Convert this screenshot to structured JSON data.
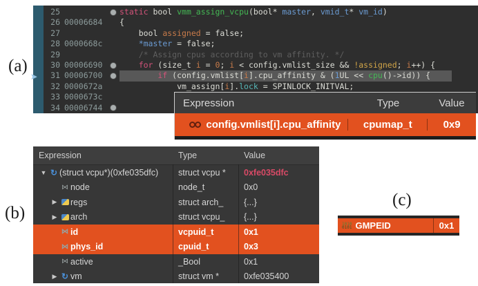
{
  "labels": {
    "a": "(a)",
    "b": "(b)",
    "c": "(c)"
  },
  "icons": {
    "instruction_pointer": "➤",
    "pointer": "↻",
    "variable": "⋈",
    "expander_open": "▼",
    "expander_closed": "▶",
    "reg_bits_line1": "1010",
    "reg_bits_line2": "0101"
  },
  "colors": {
    "selection_orange": "#e2511f",
    "editor_bg": "#2e2e2e",
    "gutter_teal": "#2d5b6e",
    "changed_value_red": "#d84a66",
    "pointer_blue": "#4a90d9"
  },
  "editor": {
    "lines": [
      {
        "num": "25",
        "addr": "",
        "bp": true,
        "current": false,
        "tokens": [
          [
            "k",
            "static"
          ],
          [
            "w",
            " bool "
          ],
          [
            "f",
            "vmm_assign_vcpu"
          ],
          [
            "w",
            "(bool* "
          ],
          [
            "v",
            "master"
          ],
          [
            "w",
            ", "
          ],
          [
            "v",
            "vmid_t"
          ],
          [
            "w",
            "* "
          ],
          [
            "v",
            "vm_id"
          ],
          [
            "w",
            ")"
          ]
        ]
      },
      {
        "num": "26",
        "addr": "00006684",
        "bp": false,
        "current": false,
        "tokens": [
          [
            "w",
            "{"
          ]
        ]
      },
      {
        "num": "27",
        "addr": "",
        "bp": false,
        "current": false,
        "tokens": [
          [
            "w",
            "    bool "
          ],
          [
            "o",
            "assigned"
          ],
          [
            "w",
            " = false;"
          ]
        ]
      },
      {
        "num": "28",
        "addr": "0000668c",
        "bp": false,
        "current": false,
        "tokens": [
          [
            "w",
            "    "
          ],
          [
            "v",
            "*master"
          ],
          [
            "w",
            " = false;"
          ]
        ]
      },
      {
        "num": "29",
        "addr": "",
        "bp": false,
        "current": false,
        "tokens": [
          [
            "c",
            "    /* Assign cpus according to vm affinity. */"
          ]
        ]
      },
      {
        "num": "30",
        "addr": "00006690",
        "bp": true,
        "current": false,
        "tokens": [
          [
            "k",
            "    for"
          ],
          [
            "w",
            " (size_t "
          ],
          [
            "o",
            "i"
          ],
          [
            "w",
            " = "
          ],
          [
            "o",
            "0"
          ],
          [
            "w",
            "; "
          ],
          [
            "o",
            "i"
          ],
          [
            "w",
            " < config.vmlist_size && "
          ],
          [
            "y",
            "!assigned"
          ],
          [
            "w",
            "; "
          ],
          [
            "o",
            "i"
          ],
          [
            "w",
            "++) {"
          ]
        ]
      },
      {
        "num": "31",
        "addr": "00006700",
        "bp": true,
        "current": true,
        "tokens": [
          [
            "k",
            "        if"
          ],
          [
            "w",
            " (config.vmlist["
          ],
          [
            "o",
            "i"
          ],
          [
            "w",
            "].cpu_affinity & ("
          ],
          [
            "v",
            "1"
          ],
          [
            "w",
            "UL << "
          ],
          [
            "f",
            "cpu"
          ],
          [
            "w",
            "()->id)) {"
          ]
        ]
      },
      {
        "num": "32",
        "addr": "0000672a",
        "bp": false,
        "current": false,
        "tokens": [
          [
            "w",
            "            vm_assign["
          ],
          [
            "o",
            "i"
          ],
          [
            "w",
            "]."
          ],
          [
            "t",
            "lock"
          ],
          [
            "w",
            " = SPINLOCK_INITVAL;"
          ]
        ]
      },
      {
        "num": "33",
        "addr": "0000673c",
        "bp": false,
        "current": false,
        "tokens": []
      },
      {
        "num": "34",
        "addr": "00006744",
        "bp": true,
        "current": false,
        "tokens": []
      }
    ]
  },
  "watch_popup": {
    "headers": [
      "Expression",
      "Type",
      "Value"
    ],
    "row": {
      "expression": "config.vmlist[i].cpu_affinity",
      "type": "cpumap_t",
      "value": "0x9"
    }
  },
  "variables_table": {
    "headers": [
      "Expression",
      "Type",
      "Value"
    ],
    "rows": [
      {
        "expander": "▼",
        "icon": "pointer",
        "indent": 0,
        "name": "(struct vcpu*)(0xfe035dfc)",
        "type": "struct vcpu *",
        "value": "0xfe035dfc",
        "red": true,
        "selected": false
      },
      {
        "expander": "",
        "icon": "var",
        "indent": 1,
        "name": "node",
        "type": "node_t",
        "value": "0x0",
        "red": false,
        "selected": false
      },
      {
        "expander": "▶",
        "icon": "struct",
        "indent": 1,
        "name": "regs",
        "type": "struct arch_",
        "value": "{...}",
        "red": false,
        "selected": false
      },
      {
        "expander": "▶",
        "icon": "struct",
        "indent": 1,
        "name": "arch",
        "type": "struct vcpu_",
        "value": "{...}",
        "red": false,
        "selected": false
      },
      {
        "expander": "",
        "icon": "var",
        "indent": 1,
        "name": "id",
        "type": "vcpuid_t",
        "value": "0x1",
        "red": false,
        "selected": true
      },
      {
        "expander": "",
        "icon": "var",
        "indent": 1,
        "name": "phys_id",
        "type": "cpuid_t",
        "value": "0x3",
        "red": false,
        "selected": true
      },
      {
        "expander": "",
        "icon": "var",
        "indent": 1,
        "name": "active",
        "type": "_Bool",
        "value": "0x1",
        "red": false,
        "selected": false
      },
      {
        "expander": "▶",
        "icon": "pointer",
        "indent": 1,
        "name": "vm",
        "type": "struct vm *",
        "value": "0xfe035400",
        "red": false,
        "selected": false
      }
    ]
  },
  "register_bar": {
    "name": "GMPEID",
    "value": "0x1"
  }
}
